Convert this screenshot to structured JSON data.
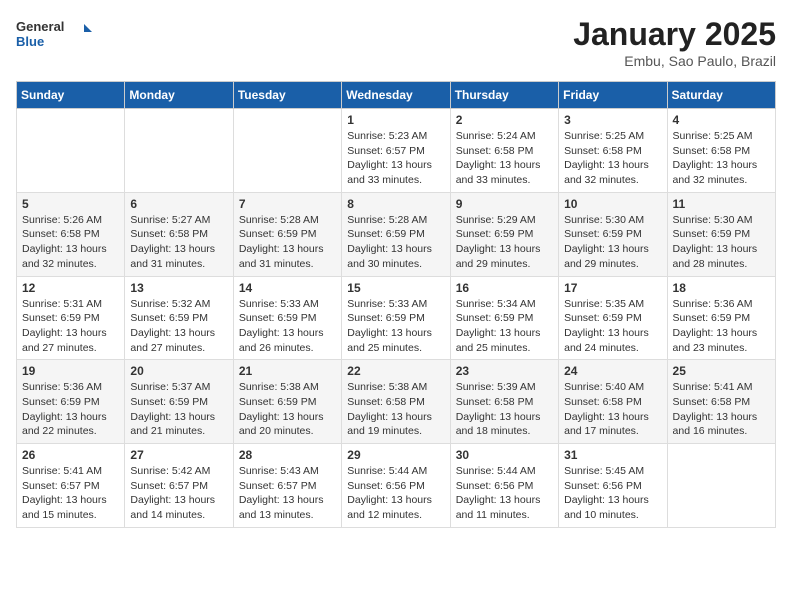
{
  "header": {
    "logo_line1": "General",
    "logo_line2": "Blue",
    "month": "January 2025",
    "location": "Embu, Sao Paulo, Brazil"
  },
  "days_of_week": [
    "Sunday",
    "Monday",
    "Tuesday",
    "Wednesday",
    "Thursday",
    "Friday",
    "Saturday"
  ],
  "weeks": [
    [
      {
        "day": "",
        "info": ""
      },
      {
        "day": "",
        "info": ""
      },
      {
        "day": "",
        "info": ""
      },
      {
        "day": "1",
        "info": "Sunrise: 5:23 AM\nSunset: 6:57 PM\nDaylight: 13 hours and 33 minutes."
      },
      {
        "day": "2",
        "info": "Sunrise: 5:24 AM\nSunset: 6:58 PM\nDaylight: 13 hours and 33 minutes."
      },
      {
        "day": "3",
        "info": "Sunrise: 5:25 AM\nSunset: 6:58 PM\nDaylight: 13 hours and 32 minutes."
      },
      {
        "day": "4",
        "info": "Sunrise: 5:25 AM\nSunset: 6:58 PM\nDaylight: 13 hours and 32 minutes."
      }
    ],
    [
      {
        "day": "5",
        "info": "Sunrise: 5:26 AM\nSunset: 6:58 PM\nDaylight: 13 hours and 32 minutes."
      },
      {
        "day": "6",
        "info": "Sunrise: 5:27 AM\nSunset: 6:58 PM\nDaylight: 13 hours and 31 minutes."
      },
      {
        "day": "7",
        "info": "Sunrise: 5:28 AM\nSunset: 6:59 PM\nDaylight: 13 hours and 31 minutes."
      },
      {
        "day": "8",
        "info": "Sunrise: 5:28 AM\nSunset: 6:59 PM\nDaylight: 13 hours and 30 minutes."
      },
      {
        "day": "9",
        "info": "Sunrise: 5:29 AM\nSunset: 6:59 PM\nDaylight: 13 hours and 29 minutes."
      },
      {
        "day": "10",
        "info": "Sunrise: 5:30 AM\nSunset: 6:59 PM\nDaylight: 13 hours and 29 minutes."
      },
      {
        "day": "11",
        "info": "Sunrise: 5:30 AM\nSunset: 6:59 PM\nDaylight: 13 hours and 28 minutes."
      }
    ],
    [
      {
        "day": "12",
        "info": "Sunrise: 5:31 AM\nSunset: 6:59 PM\nDaylight: 13 hours and 27 minutes."
      },
      {
        "day": "13",
        "info": "Sunrise: 5:32 AM\nSunset: 6:59 PM\nDaylight: 13 hours and 27 minutes."
      },
      {
        "day": "14",
        "info": "Sunrise: 5:33 AM\nSunset: 6:59 PM\nDaylight: 13 hours and 26 minutes."
      },
      {
        "day": "15",
        "info": "Sunrise: 5:33 AM\nSunset: 6:59 PM\nDaylight: 13 hours and 25 minutes."
      },
      {
        "day": "16",
        "info": "Sunrise: 5:34 AM\nSunset: 6:59 PM\nDaylight: 13 hours and 25 minutes."
      },
      {
        "day": "17",
        "info": "Sunrise: 5:35 AM\nSunset: 6:59 PM\nDaylight: 13 hours and 24 minutes."
      },
      {
        "day": "18",
        "info": "Sunrise: 5:36 AM\nSunset: 6:59 PM\nDaylight: 13 hours and 23 minutes."
      }
    ],
    [
      {
        "day": "19",
        "info": "Sunrise: 5:36 AM\nSunset: 6:59 PM\nDaylight: 13 hours and 22 minutes."
      },
      {
        "day": "20",
        "info": "Sunrise: 5:37 AM\nSunset: 6:59 PM\nDaylight: 13 hours and 21 minutes."
      },
      {
        "day": "21",
        "info": "Sunrise: 5:38 AM\nSunset: 6:59 PM\nDaylight: 13 hours and 20 minutes."
      },
      {
        "day": "22",
        "info": "Sunrise: 5:38 AM\nSunset: 6:58 PM\nDaylight: 13 hours and 19 minutes."
      },
      {
        "day": "23",
        "info": "Sunrise: 5:39 AM\nSunset: 6:58 PM\nDaylight: 13 hours and 18 minutes."
      },
      {
        "day": "24",
        "info": "Sunrise: 5:40 AM\nSunset: 6:58 PM\nDaylight: 13 hours and 17 minutes."
      },
      {
        "day": "25",
        "info": "Sunrise: 5:41 AM\nSunset: 6:58 PM\nDaylight: 13 hours and 16 minutes."
      }
    ],
    [
      {
        "day": "26",
        "info": "Sunrise: 5:41 AM\nSunset: 6:57 PM\nDaylight: 13 hours and 15 minutes."
      },
      {
        "day": "27",
        "info": "Sunrise: 5:42 AM\nSunset: 6:57 PM\nDaylight: 13 hours and 14 minutes."
      },
      {
        "day": "28",
        "info": "Sunrise: 5:43 AM\nSunset: 6:57 PM\nDaylight: 13 hours and 13 minutes."
      },
      {
        "day": "29",
        "info": "Sunrise: 5:44 AM\nSunset: 6:56 PM\nDaylight: 13 hours and 12 minutes."
      },
      {
        "day": "30",
        "info": "Sunrise: 5:44 AM\nSunset: 6:56 PM\nDaylight: 13 hours and 11 minutes."
      },
      {
        "day": "31",
        "info": "Sunrise: 5:45 AM\nSunset: 6:56 PM\nDaylight: 13 hours and 10 minutes."
      },
      {
        "day": "",
        "info": ""
      }
    ]
  ]
}
